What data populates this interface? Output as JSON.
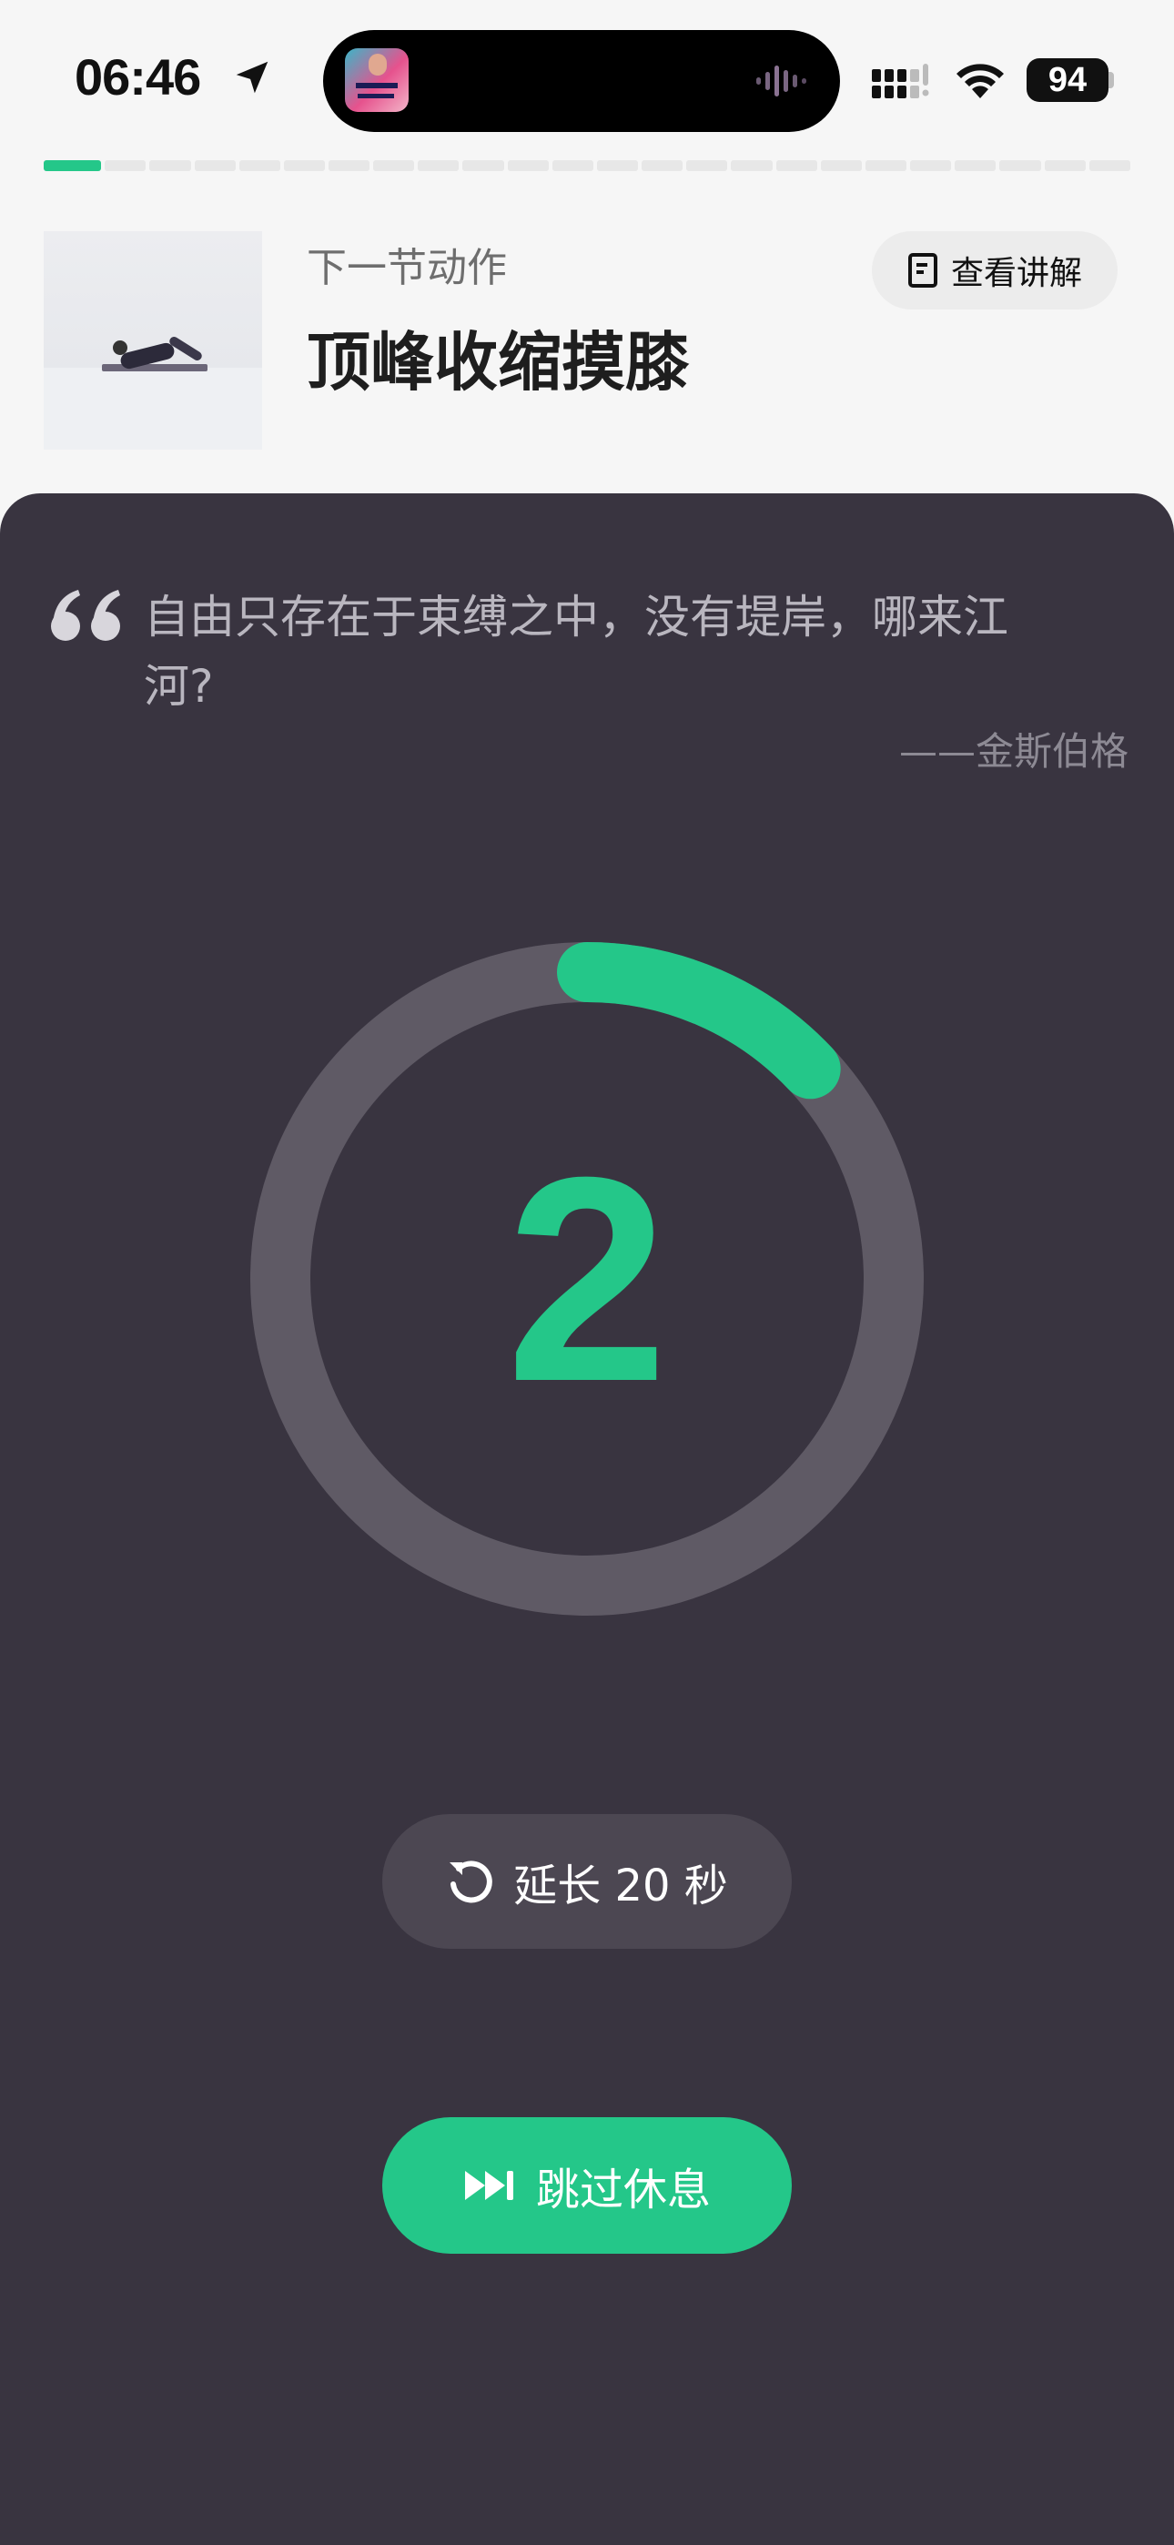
{
  "status_bar": {
    "time": "06:46",
    "battery": "94"
  },
  "progress": {
    "segments_total": 24,
    "segments_done": 1
  },
  "next_action": {
    "label": "下一节动作",
    "title": "顶峰收缩摸膝",
    "explain_button": "查看讲解"
  },
  "quote": {
    "text": "自由只存在于束缚之中，没有堤岸，哪来江河?",
    "author": "——金斯伯格"
  },
  "timer": {
    "value": "2",
    "progress_fraction": 0.13,
    "accent_color": "#24c789",
    "track_color": "#5f5a65"
  },
  "actions": {
    "extend_label": "延长 20 秒",
    "skip_label": "跳过休息"
  },
  "icons": {
    "location": "location-arrow-icon",
    "signal": "cellular-signal-icon",
    "wifi": "wifi-icon",
    "quote": "quote-icon",
    "explain": "document-icon",
    "extend": "refresh-icon",
    "skip": "fast-forward-icon"
  }
}
